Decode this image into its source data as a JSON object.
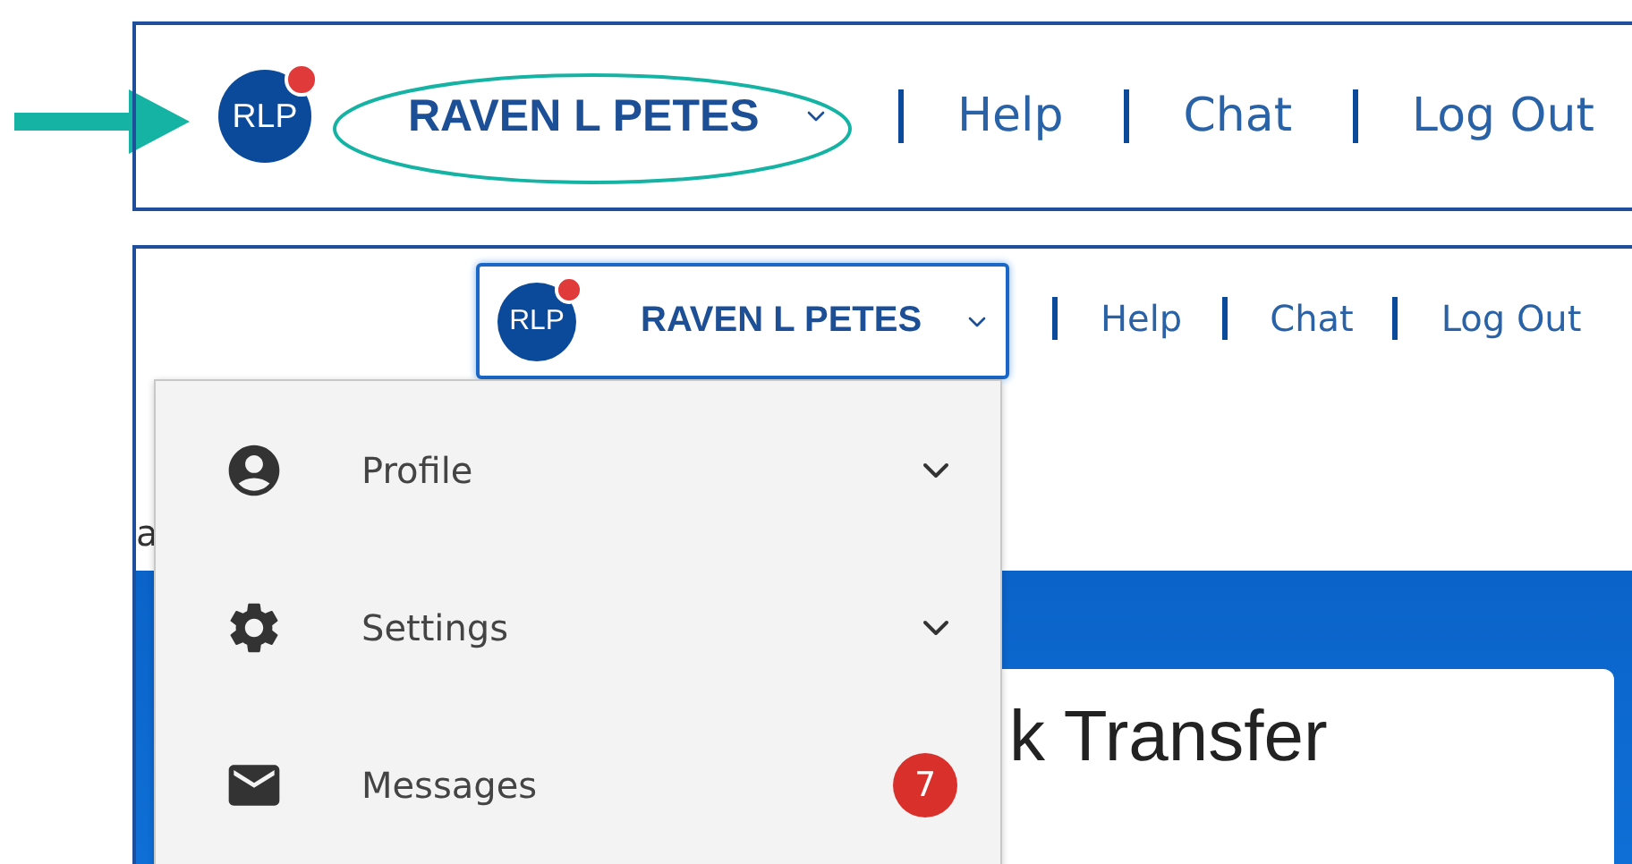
{
  "header_preview": {
    "avatar": "RLP",
    "notification": true,
    "user_name": "RAVEN L PETES",
    "links": [
      "Help",
      "Chat",
      "Log Out"
    ]
  },
  "header_open": {
    "avatar": "RLP",
    "notification": true,
    "user_name": "RAVEN L PETES",
    "expanded": true,
    "links": [
      "Help",
      "Chat",
      "Log Out"
    ]
  },
  "user_menu": {
    "items": [
      {
        "label": "Profile",
        "kind": "expandable"
      },
      {
        "label": "Settings",
        "kind": "expandable"
      },
      {
        "label": "Messages",
        "kind": "count",
        "badge": "7"
      }
    ]
  },
  "page": {
    "fragment": "a",
    "card_title": "k Transfer"
  }
}
